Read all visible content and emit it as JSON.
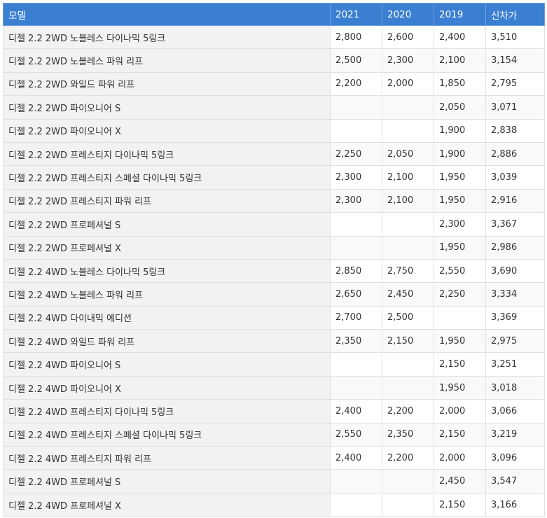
{
  "table": {
    "headers": [
      "모델",
      "2021",
      "2020",
      "2019",
      "신차가"
    ],
    "rows": [
      [
        "디젤 2.2 2WD 노블레스 다이나믹 5링크",
        "2,800",
        "2,600",
        "2,400",
        "3,510"
      ],
      [
        "디젤 2.2 2WD 노블레스 파워 리프",
        "2,500",
        "2,300",
        "2,100",
        "3,154"
      ],
      [
        "디젤 2.2 2WD 와일드 파워 리프",
        "2,200",
        "2,000",
        "1,850",
        "2,795"
      ],
      [
        "디젤 2.2 2WD 파이오니어 S",
        "",
        "",
        "2,050",
        "3,071"
      ],
      [
        "디젤 2.2 2WD 파이오니어 X",
        "",
        "",
        "1,900",
        "2,838"
      ],
      [
        "디젤 2.2 2WD 프레스티지 다이나믹 5링크",
        "2,250",
        "2,050",
        "1,900",
        "2,886"
      ],
      [
        "디젤 2.2 2WD 프레스티지 스페셜 다이나믹 5링크",
        "2,300",
        "2,100",
        "1,950",
        "3,039"
      ],
      [
        "디젤 2.2 2WD 프레스티지 파워 리프",
        "2,300",
        "2,100",
        "1,950",
        "2,916"
      ],
      [
        "디젤 2.2 2WD 프로페셔널 S",
        "",
        "",
        "2,300",
        "3,367"
      ],
      [
        "디젤 2.2 2WD 프로페셔널 X",
        "",
        "",
        "1,950",
        "2,986"
      ],
      [
        "디젤 2.2 4WD 노블레스 다이나믹 5링크",
        "2,850",
        "2,750",
        "2,550",
        "3,690"
      ],
      [
        "디젤 2.2 4WD 노블레스 파워 리프",
        "2,650",
        "2,450",
        "2,250",
        "3,334"
      ],
      [
        "디젤 2.2 4WD 다이내믹 에디션",
        "2,700",
        "2,500",
        "",
        "3,369"
      ],
      [
        "디젤 2.2 4WD 와일드 파워 리프",
        "2,350",
        "2,150",
        "1,950",
        "2,975"
      ],
      [
        "디젤 2.2 4WD 파이오니어 S",
        "",
        "",
        "2,150",
        "3,251"
      ],
      [
        "디젤 2.2 4WD 파이오니어 X",
        "",
        "",
        "1,950",
        "3,018"
      ],
      [
        "디젤 2.2 4WD 프레스티지 다이나믹 5링크",
        "2,400",
        "2,200",
        "2,000",
        "3,066"
      ],
      [
        "디젤 2.2 4WD 프레스티지 스페셜 다이나믹 5링크",
        "2,550",
        "2,350",
        "2,150",
        "3,219"
      ],
      [
        "디젤 2.2 4WD 프레스티지 파워 리프",
        "2,400",
        "2,200",
        "2,000",
        "3,096"
      ],
      [
        "디젤 2.2 4WD 프로페셔널 S",
        "",
        "",
        "2,450",
        "3,547"
      ],
      [
        "디젤 2.2 4WD 프로페셔널 X",
        "",
        "",
        "2,150",
        "3,166"
      ]
    ]
  },
  "colors": {
    "header_bg": "#3b7fd3",
    "header_text": "#ffffff",
    "model_cell_bg": "#f2f2f2",
    "border": "#e0e0e0"
  }
}
